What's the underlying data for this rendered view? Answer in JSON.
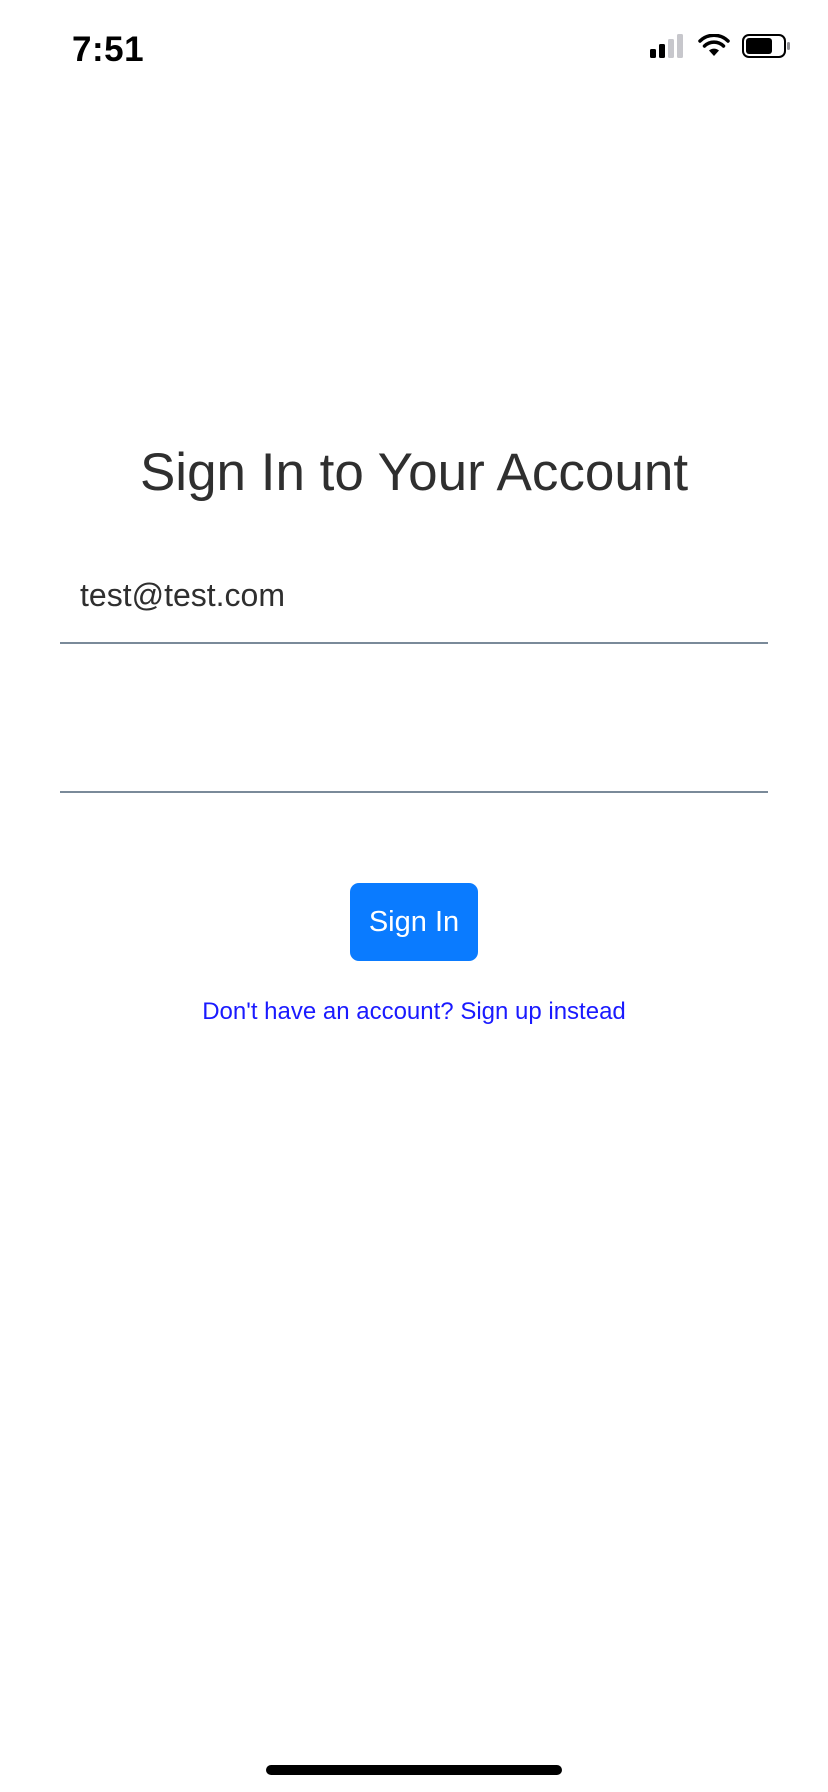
{
  "status_bar": {
    "time": "7:51",
    "icons": [
      "cellular-signal-icon",
      "wifi-icon",
      "battery-icon"
    ]
  },
  "signin": {
    "title": "Sign In to Your Account",
    "email_value": "test@test.com",
    "password_value": "",
    "button_label": "Sign In",
    "signup_link": "Don't have an account? Sign up instead"
  },
  "colors": {
    "accent": "#0a7bff",
    "link": "#1a1aff",
    "title_text": "#2f2f2f",
    "field_underline": "#7a8a99"
  }
}
